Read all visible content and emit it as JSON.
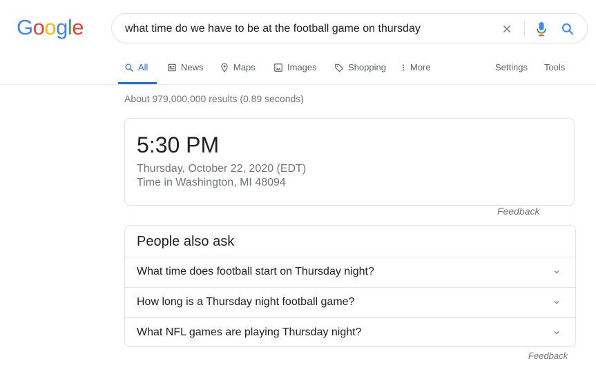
{
  "logo": {
    "letters": [
      "G",
      "o",
      "o",
      "g",
      "l",
      "e"
    ]
  },
  "search": {
    "query": "what time do we have to be at the football game on thursday"
  },
  "tabs": [
    {
      "label": "All",
      "icon": "search-icon",
      "active": true
    },
    {
      "label": "News",
      "icon": "news-icon"
    },
    {
      "label": "Maps",
      "icon": "map-pin-icon"
    },
    {
      "label": "Images",
      "icon": "image-icon"
    },
    {
      "label": "Shopping",
      "icon": "tag-icon"
    },
    {
      "label": "More",
      "icon": "more-vert-icon"
    }
  ],
  "tools": {
    "settings": "Settings",
    "tools": "Tools"
  },
  "result_stats": "About 979,000,000 results (0.89 seconds)",
  "time_card": {
    "time": "5:30 PM",
    "date": "Thursday, October 22, 2020 (EDT)",
    "place": "Time in Washington, MI 48094",
    "feedback": "Feedback"
  },
  "people_also_ask": {
    "title": "People also ask",
    "questions": [
      "What time does football start on Thursday night?",
      "How long is a Thursday night football game?",
      "What NFL games are playing Thursday night?"
    ],
    "feedback": "Feedback"
  },
  "colors": {
    "google_blue": "#4285F4",
    "google_red": "#EA4335",
    "google_yellow": "#FBBC05",
    "google_green": "#34A853",
    "link_blue": "#1a73e8",
    "muted_text": "#70757a"
  }
}
